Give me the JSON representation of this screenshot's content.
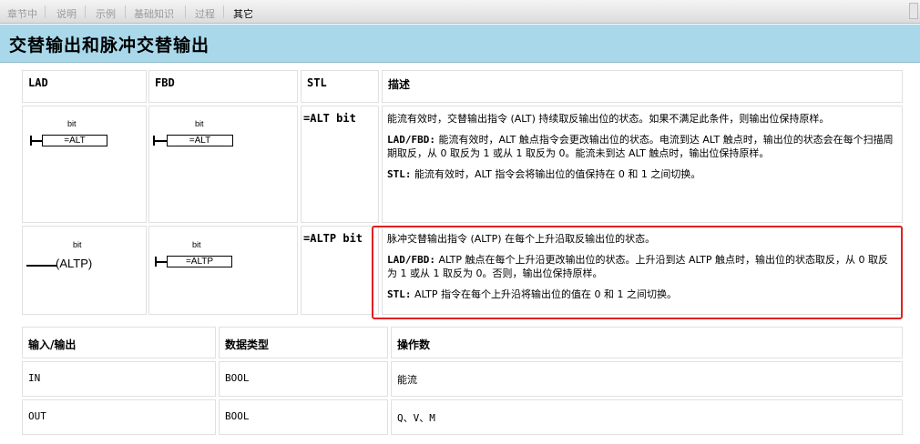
{
  "tabs": [
    {
      "label": "章节中",
      "active": false
    },
    {
      "label": "说明",
      "active": false
    },
    {
      "label": "示例",
      "active": false
    },
    {
      "label": "基础知识",
      "active": false
    },
    {
      "label": "过程",
      "active": false
    },
    {
      "label": "其它",
      "active": true
    }
  ],
  "page_title": "交替输出和脉冲交替输出",
  "instr_table": {
    "headers": [
      "LAD",
      "FBD",
      "STL",
      "描述"
    ],
    "rows": [
      {
        "lad_bit": "bit",
        "lad_box": "=ALT",
        "fbd_bit": "bit",
        "fbd_box": "=ALT",
        "stl": "=ALT bit",
        "desc1": "能流有效时，交替输出指令 (ALT) 持续取反输出位的状态。如果不满足此条件，则输出位保持原样。",
        "desc2_label": "LAD/FBD:",
        "desc2": "能流有效时，ALT 触点指令会更改输出位的状态。电流到达 ALT 触点时，输出位的状态会在每个扫描周期取反，从 0 取反为 1 或从 1 取反为 0。能流未到达 ALT 触点时，输出位保持原样。",
        "desc3_label": "STL:",
        "desc3": "能流有效时，ALT 指令会将输出位的值保持在 0 和 1 之间切换。"
      },
      {
        "lad_bit": "bit",
        "lad_coil": "ALTP",
        "fbd_bit": "bit",
        "fbd_box": "=ALTP",
        "stl": "=ALTP bit",
        "desc1": "脉冲交替输出指令 (ALTP) 在每个上升沿取反输出位的状态。",
        "desc2_label": "LAD/FBD:",
        "desc2": "ALTP 触点在每个上升沿更改输出位的状态。上升沿到达 ALTP 触点时，输出位的状态取反，从 0 取反为 1 或从 1 取反为 0。否则，输出位保持原样。",
        "desc3_label": "STL:",
        "desc3": "ALTP 指令在每个上升沿将输出位的值在 0 和 1 之间切换。"
      }
    ]
  },
  "io_table": {
    "headers": [
      "输入/输出",
      "数据类型",
      "操作数"
    ],
    "rows": [
      [
        "IN",
        "BOOL",
        "能流"
      ],
      [
        "OUT",
        "BOOL",
        "Q、V、M"
      ]
    ]
  },
  "colors": {
    "title_bg": "#a8d8ea",
    "highlight": "#e02020"
  }
}
